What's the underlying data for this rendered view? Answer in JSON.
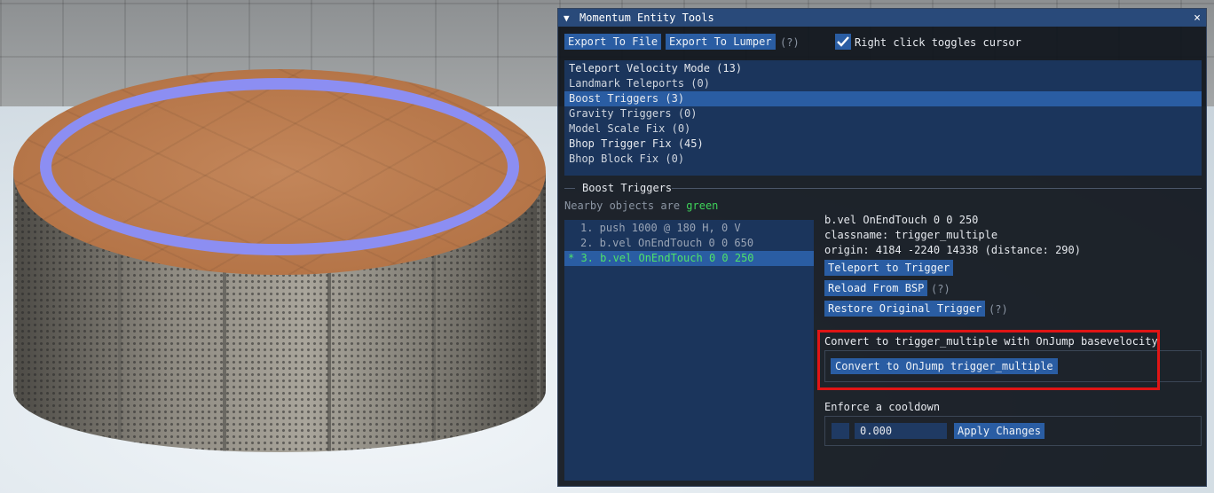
{
  "window": {
    "title": "Momentum Entity Tools",
    "collapse_glyph": "▼",
    "close_glyph": "×"
  },
  "toolbar": {
    "export_file": "Export To File",
    "export_lumper": "Export To Lumper",
    "help": "(?)",
    "checkbox_checked": true,
    "checkbox_label": "Right click toggles cursor"
  },
  "tools": [
    {
      "label": "Teleport Velocity Mode (13)"
    },
    {
      "label": "Landmark Teleports (0)"
    },
    {
      "label": "Boost Triggers (3)"
    },
    {
      "label": "Gravity Triggers (0)"
    },
    {
      "label": "Model Scale Fix (0)"
    },
    {
      "label": "Bhop Trigger Fix (45)"
    },
    {
      "label": "Bhop Block Fix (0)"
    }
  ],
  "selected_tool": "Boost Triggers (3)",
  "section": {
    "title": "Boost Triggers",
    "nearby_prefix": "Nearby objects are",
    "nearby_color_word": "green",
    "nearby_color": "#3fd45a"
  },
  "objects": [
    {
      "label": "1. push 1000 @ 180 H, 0 V"
    },
    {
      "label": "2. b.vel OnEndTouch 0 0 650"
    },
    {
      "label": "* 3. b.vel OnEndTouch 0 0 250"
    }
  ],
  "detail": {
    "name": "b.vel OnEndTouch 0 0 250",
    "classname": "classname: trigger_multiple",
    "origin": "origin: 4184 -2240 14338 (distance: 290)",
    "teleport_btn": "Teleport to Trigger",
    "reload_btn": "Reload From BSP",
    "reload_help": "(?)",
    "restore_btn": "Restore Original Trigger",
    "restore_help": "(?)",
    "convert_heading": "Convert to trigger_multiple with OnJump basevelocity",
    "convert_btn": "Convert to OnJump trigger_multiple",
    "cooldown_heading": "Enforce a cooldown",
    "cooldown_value": "0.000",
    "apply_btn": "Apply Changes"
  },
  "colors": {
    "accent": "#2a5da3",
    "title_bar": "#294a7a",
    "highlight": "#e01515",
    "selected_text": "#4ee26a"
  }
}
